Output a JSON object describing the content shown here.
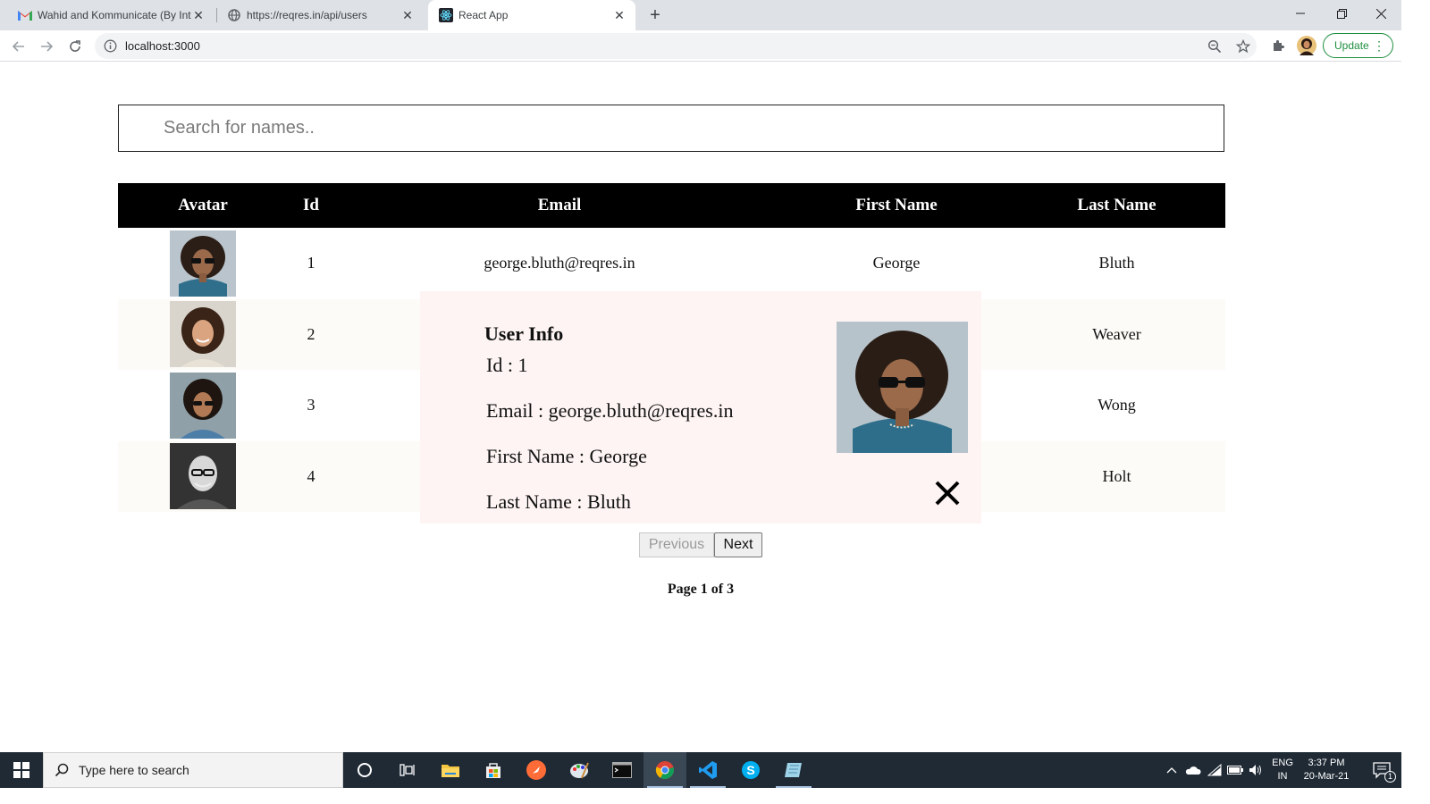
{
  "browser": {
    "tabs": [
      {
        "title": "Wahid and Kommunicate (By Inte"
      },
      {
        "title": "https://reqres.in/api/users"
      },
      {
        "title": "React App"
      }
    ],
    "address": "localhost:3000",
    "update_label": "Update"
  },
  "search": {
    "placeholder": "Search for names.."
  },
  "table": {
    "headers": [
      "Avatar",
      "Id",
      "Email",
      "First Name",
      "Last Name"
    ],
    "rows": [
      {
        "id": "1",
        "email": "george.bluth@reqres.in",
        "first_name": "George",
        "last_name": "Bluth"
      },
      {
        "id": "2",
        "last_name": "Weaver"
      },
      {
        "id": "3",
        "last_name": "Wong"
      },
      {
        "id": "4",
        "last_name": "Holt"
      }
    ]
  },
  "modal": {
    "title": "User Info",
    "id_line": "Id : 1",
    "email_line": "Email : george.bluth@reqres.in",
    "first_name_line": "First Name : George",
    "last_name_line": "Last Name : Bluth"
  },
  "pagination": {
    "previous_label": "Previous",
    "next_label": "Next",
    "page_text": "Page 1 of 3"
  },
  "taskbar": {
    "search_placeholder": "Type here to search",
    "lang_line1": "ENG",
    "lang_line2": "IN",
    "time": "3:37 PM",
    "date": "20-Mar-21",
    "notification_count": "1"
  },
  "colors": {
    "header_bg": "#000000",
    "modal_bg": "#fdf4f3",
    "update_green": "#1e8e3e",
    "taskbar_bg": "#1f2a35"
  }
}
